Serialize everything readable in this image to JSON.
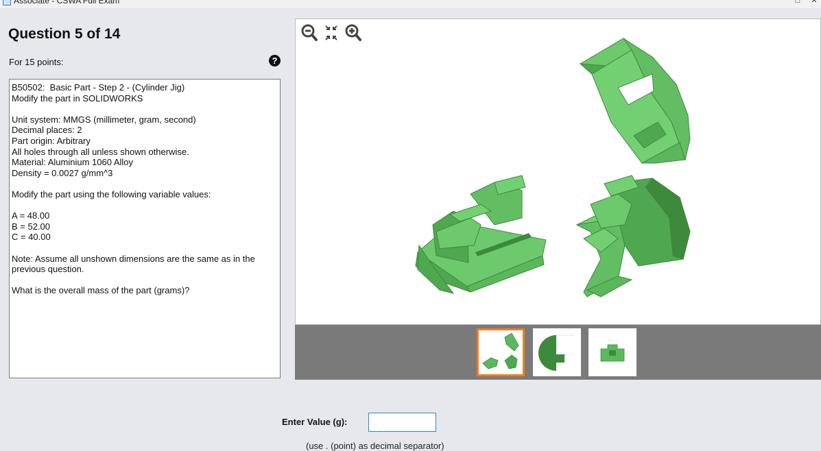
{
  "window": {
    "title": "Associate - CSWA Full Exam"
  },
  "question": {
    "title": "Question 5 of 14",
    "points": "For 15 points:",
    "lines": [
      "B50502:  Basic Part - Step 2 - (Cylinder Jig)",
      "Modify the part in SOLIDWORKS",
      "",
      "Unit system: MMGS (millimeter, gram, second)",
      "Decimal places: 2",
      "Part origin: Arbitrary",
      "All holes through all unless shown otherwise.",
      "Material: Aluminium 1060 Alloy",
      "Density = 0.0027 g/mm^3",
      "",
      "Modify the part using the following variable values:",
      "",
      "A = 48.00",
      "B = 52.00",
      "C = 40.00",
      "",
      "Note: Assume all unshown dimensions are the same as in the previous question.",
      "",
      "What is the overall mass of the part (grams)?"
    ]
  },
  "viewer": {
    "zoom_tools": [
      "zoom-out-icon",
      "fit-to-window-icon",
      "zoom-in-icon"
    ],
    "accent_color": "#f07f19",
    "part_color": "#5cb85c",
    "thumbnails": [
      {
        "name": "thumbnail-isometric-views",
        "selected": true
      },
      {
        "name": "thumbnail-side-view",
        "selected": false
      },
      {
        "name": "thumbnail-front-view",
        "selected": false
      }
    ]
  },
  "answer": {
    "label": "Enter Value (g):",
    "value": "",
    "hint": "(use . (point) as decimal separator)"
  }
}
